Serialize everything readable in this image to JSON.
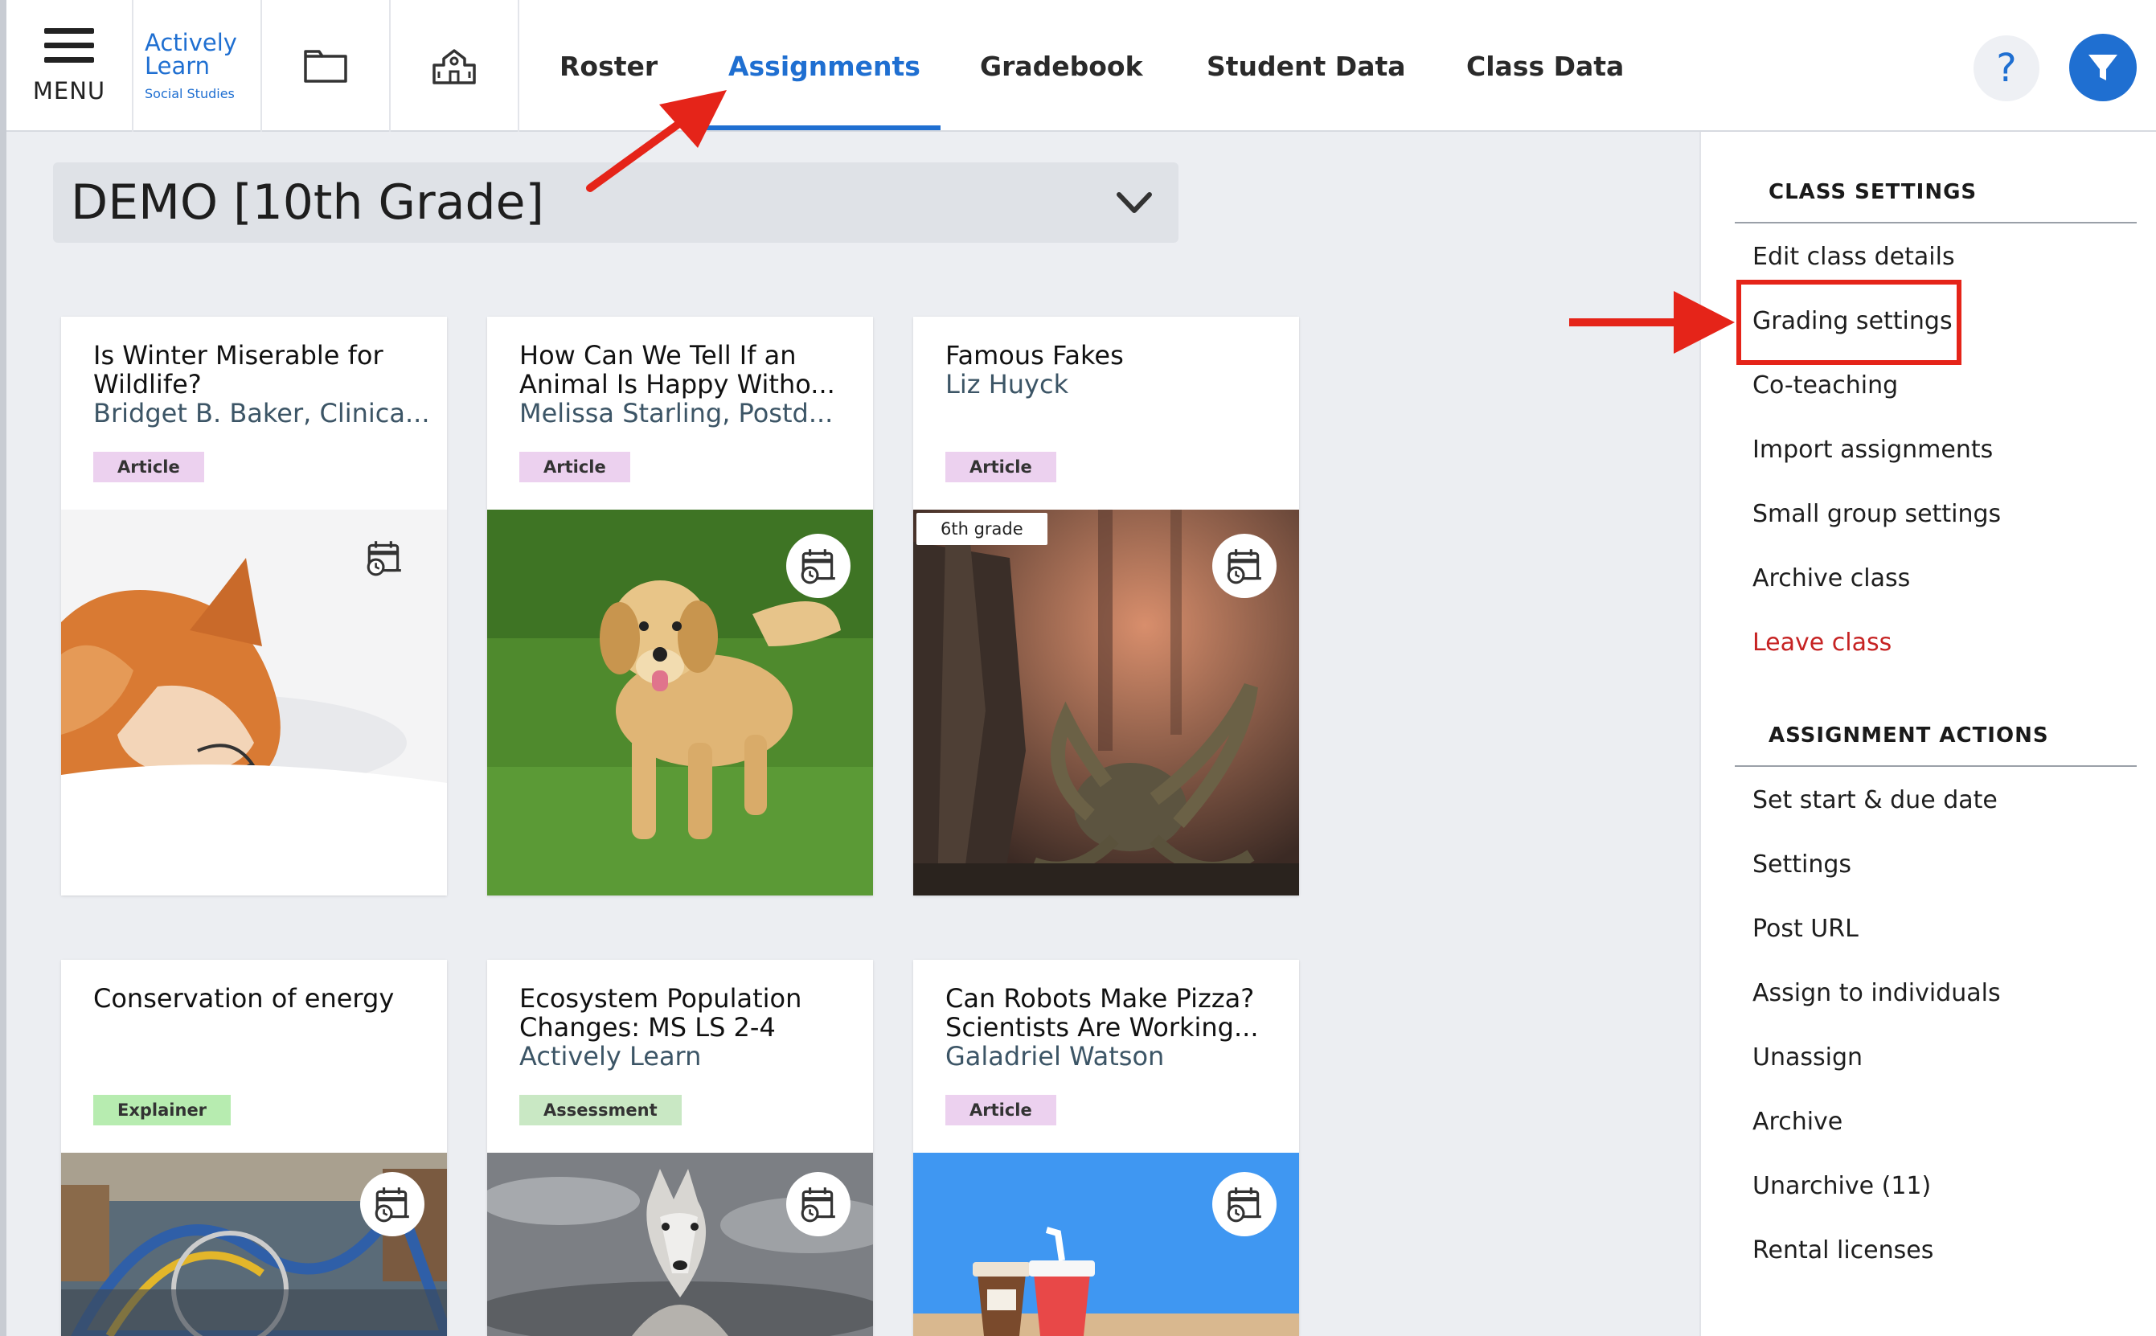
{
  "nav": {
    "menu_label": "MENU",
    "logo_line1": "Actively",
    "logo_line2": "Learn",
    "logo_sub": "Social Studies",
    "tabs": [
      {
        "label": "Roster",
        "active": false
      },
      {
        "label": "Assignments",
        "active": true
      },
      {
        "label": "Gradebook",
        "active": false
      },
      {
        "label": "Student Data",
        "active": false
      },
      {
        "label": "Class Data",
        "active": false
      }
    ],
    "help_label": "?",
    "accent_color": "#1f6fd1",
    "icons": [
      "hamburger-icon",
      "folder-icon",
      "school-icon",
      "filter-icon"
    ]
  },
  "class_select": {
    "value": "DEMO [10th Grade]"
  },
  "cards": [
    {
      "title": "Is Winter Miserable for Wildlife?",
      "author": "Bridget B. Baker, Clinica...",
      "badge": "Article",
      "image": "fox"
    },
    {
      "title": "How Can We Tell If an Animal Is Happy Witho...",
      "author": "Melissa Starling, Postd...",
      "badge": "Article",
      "image": "dog"
    },
    {
      "title": "Famous Fakes",
      "author": "Liz Huyck",
      "badge": "Article",
      "grade_tag": "6th grade",
      "image": "kraken"
    },
    {
      "title": "Conservation of energy",
      "author": "",
      "badge": "Explainer",
      "image": "amusement-park"
    },
    {
      "title": "Ecosystem Population Changes: MS LS 2-4",
      "author": "Actively Learn",
      "badge": "Assessment",
      "image": "wolf"
    },
    {
      "title": "Can Robots Make Pizza? Scientists Are Working...",
      "author": "Galadriel Watson",
      "badge": "Article",
      "image": "drinks"
    }
  ],
  "sidebar": {
    "class_settings_heading": "CLASS SETTINGS",
    "class_settings": [
      "Edit class details",
      "Grading settings",
      "Co-teaching",
      "Import assignments",
      "Small group settings",
      "Archive class",
      "Leave class"
    ],
    "assignment_actions_heading": "ASSIGNMENT ACTIONS",
    "assignment_actions": [
      "Set start & due date",
      "Settings",
      "Post URL",
      "Assign to individuals",
      "Unassign",
      "Archive",
      "Unarchive (11)",
      "Rental licenses"
    ],
    "danger_color": "#c62323"
  },
  "annotations": {
    "arrow_color": "#e52419",
    "highlighted_item": "Grading settings"
  }
}
